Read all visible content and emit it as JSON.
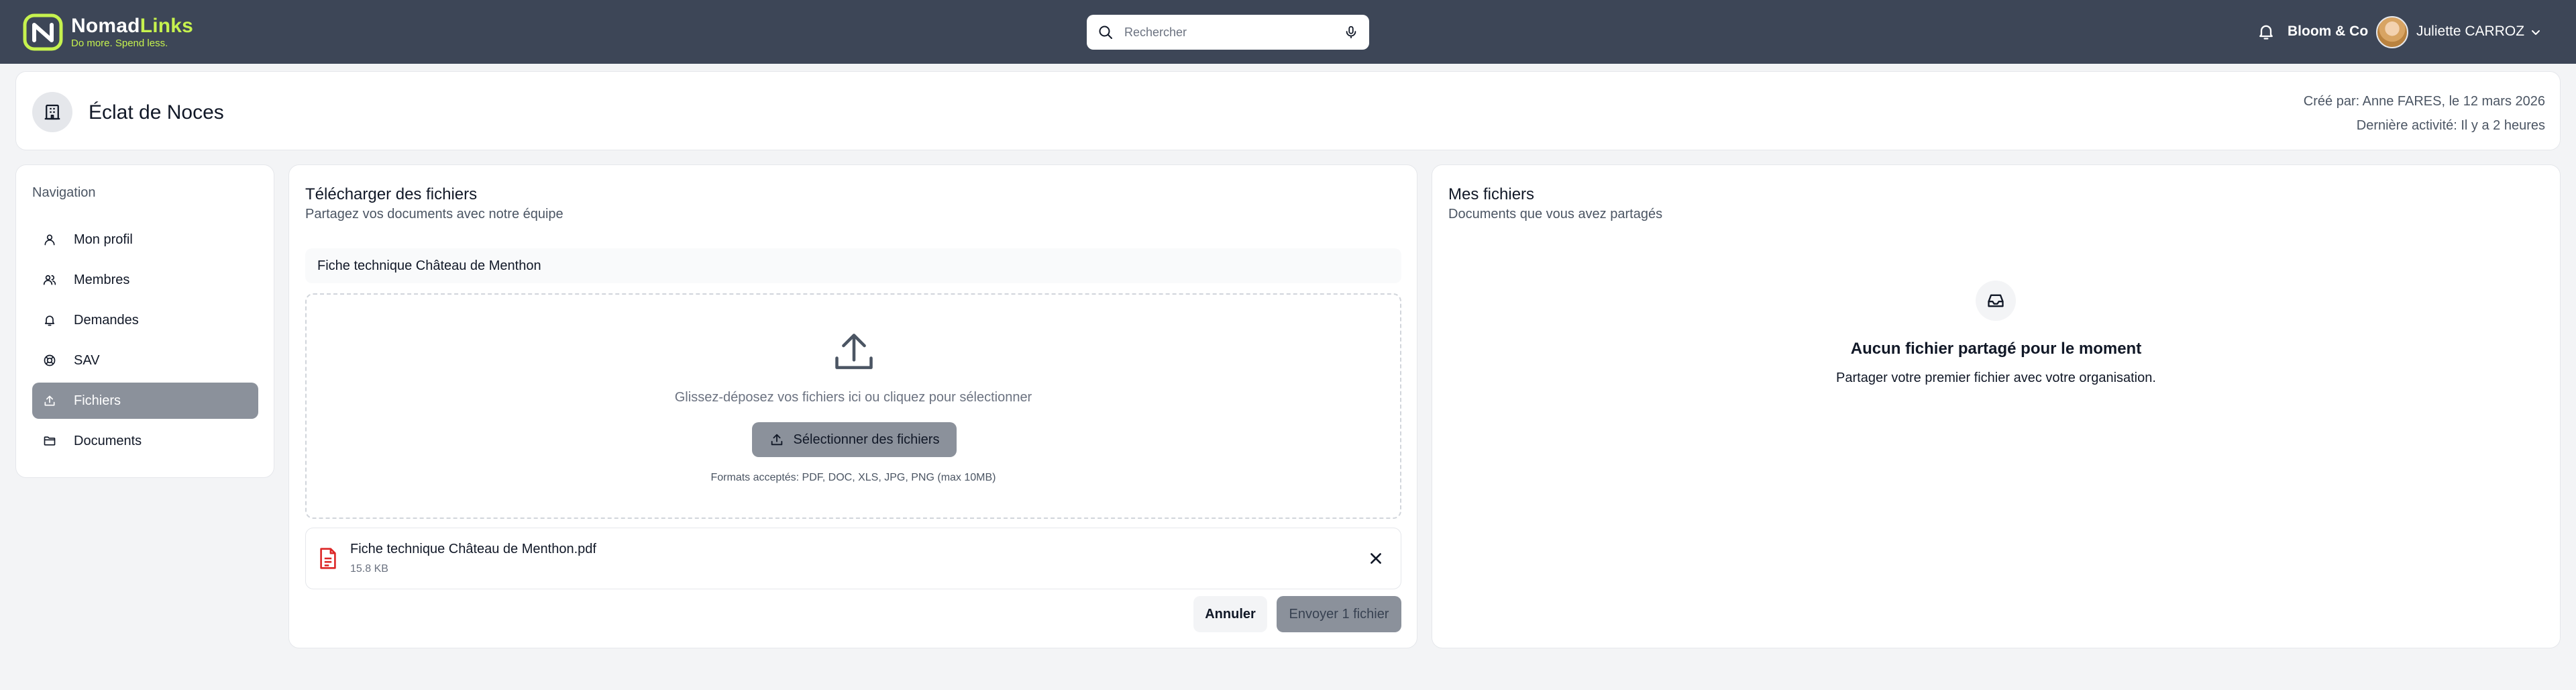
{
  "brand": {
    "name_part1": "Nomad",
    "name_part2": "Links",
    "tagline": "Do more. Spend less.",
    "accent_color": "#c6f24e",
    "topbar_color": "#3d4657"
  },
  "search": {
    "placeholder": "Rechercher",
    "icon": "search-icon",
    "mic_icon": "microphone-icon"
  },
  "topbar": {
    "notification_icon": "bell-icon",
    "organization": "Bloom & Co",
    "user_name": "Juliette CARROZ",
    "menu_icon": "chevron-down-icon"
  },
  "header": {
    "icon": "building-icon",
    "title": "Éclat de Noces",
    "created_by": "Créé par: Anne FARES, le 12 mars 2026",
    "last_activity": "Dernière activité: Il y a 2 heures"
  },
  "sidebar": {
    "title": "Navigation",
    "items": [
      {
        "label": "Mon profil",
        "icon": "user-icon",
        "active": false
      },
      {
        "label": "Membres",
        "icon": "users-icon",
        "active": false
      },
      {
        "label": "Demandes",
        "icon": "bell-icon",
        "active": false
      },
      {
        "label": "SAV",
        "icon": "support-icon",
        "active": false
      },
      {
        "label": "Fichiers",
        "icon": "upload-icon",
        "active": true
      },
      {
        "label": "Documents",
        "icon": "folder-icon",
        "active": false
      }
    ]
  },
  "upload": {
    "title": "Télécharger des fichiers",
    "subtitle": "Partagez vos documents avec notre équipe",
    "name_value": "Fiche technique Château de Menthon",
    "dropzone_text": "Glissez-déposez vos fichiers ici ou cliquez pour sélectionner",
    "select_label": "Sélectionner des fichiers",
    "formats": "Formats acceptés: PDF, DOC, XLS, JPG, PNG (max 10MB)",
    "file": {
      "name": "Fiche technique Château de Menthon.pdf",
      "size": "15.8 KB",
      "icon": "pdf-file-icon"
    },
    "cancel_label": "Annuler",
    "send_label": "Envoyer 1 fichier"
  },
  "my_files": {
    "title": "Mes fichiers",
    "subtitle": "Documents que vous avez partagés",
    "empty_icon": "inbox-icon",
    "empty_title": "Aucun fichier partagé pour le moment",
    "empty_subtitle": "Partager votre premier fichier avec votre organisation."
  }
}
